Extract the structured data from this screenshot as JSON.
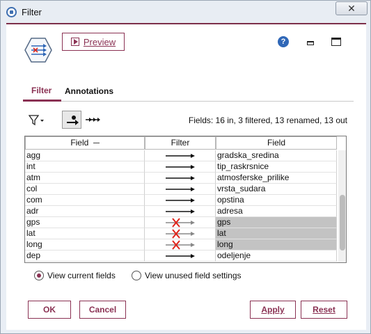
{
  "window": {
    "title": "Filter",
    "close_glyph": "✕"
  },
  "toolbar": {
    "preview_label": "Preview",
    "help_glyph": "?"
  },
  "tabs": [
    {
      "label": "Filter",
      "active": true
    },
    {
      "label": "Annotations",
      "active": false
    }
  ],
  "summary": "Fields: 16 in, 3 filtered, 13 renamed, 13 out",
  "table": {
    "headers": {
      "field": "Field",
      "filter": "Filter",
      "out": "Field"
    },
    "rows": [
      {
        "field": "agg",
        "filtered": false,
        "out": "gradska_sredina"
      },
      {
        "field": "int",
        "filtered": false,
        "out": "tip_raskrsnice"
      },
      {
        "field": "atm",
        "filtered": false,
        "out": "atmosferske_prilike"
      },
      {
        "field": "col",
        "filtered": false,
        "out": "vrsta_sudara"
      },
      {
        "field": "com",
        "filtered": false,
        "out": "opstina"
      },
      {
        "field": "adr",
        "filtered": false,
        "out": "adresa"
      },
      {
        "field": "gps",
        "filtered": true,
        "out": "gps"
      },
      {
        "field": "lat",
        "filtered": true,
        "out": "lat"
      },
      {
        "field": "long",
        "filtered": true,
        "out": "long"
      },
      {
        "field": "dep",
        "filtered": false,
        "out": "odeljenje"
      }
    ]
  },
  "view_options": {
    "current": "View current fields",
    "unused": "View unused field settings",
    "selected": "current"
  },
  "buttons": {
    "ok": "OK",
    "cancel": "Cancel",
    "apply": "Apply",
    "reset": "Reset"
  },
  "colors": {
    "accent": "#8a3153",
    "filtered_bg": "#c3c3c3",
    "cross": "#e0261c"
  }
}
